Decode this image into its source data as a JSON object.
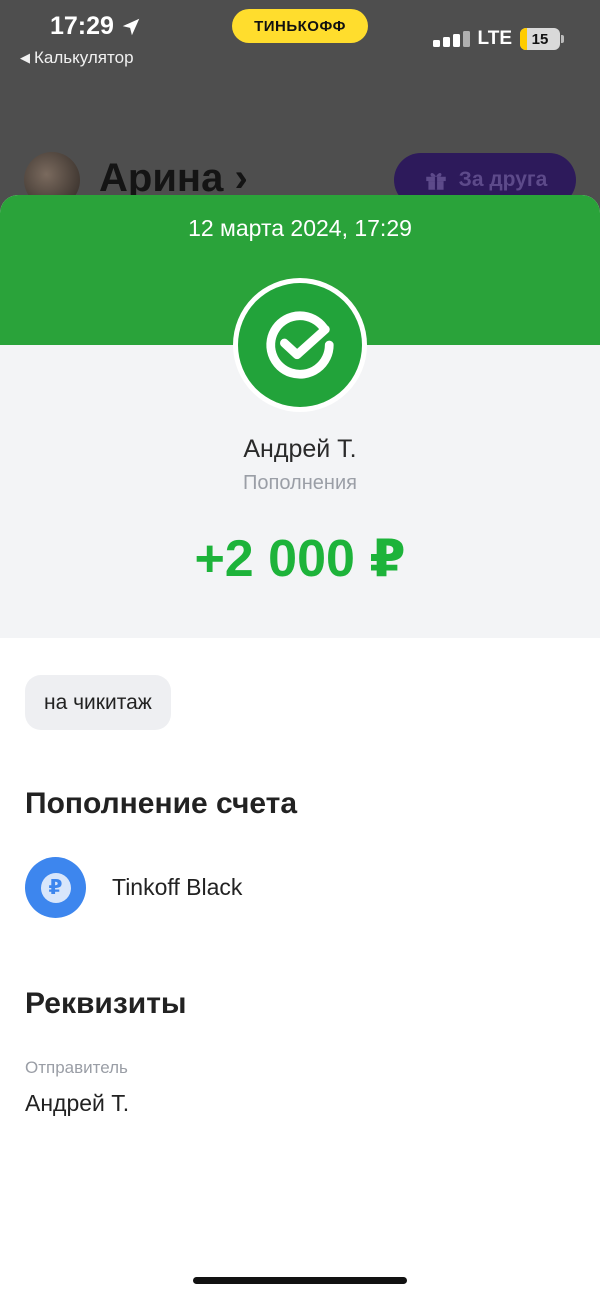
{
  "status_bar": {
    "time": "17:29",
    "back_app": "Калькулятор",
    "brand": "ТИНЬКОФФ",
    "network": "LTE",
    "battery": "15"
  },
  "background_header": {
    "name": "Арина",
    "gift_button": "За друга"
  },
  "transaction": {
    "datetime": "12 марта 2024, 17:29",
    "counterparty": "Андрей Т.",
    "category": "Пополнения",
    "amount": "+2 000 ₽",
    "comment": "на чикитаж"
  },
  "account_section": {
    "title": "Пополнение счета",
    "account_name": "Tinkoff Black",
    "account_icon": "ruble-icon"
  },
  "details_section": {
    "title": "Реквизиты",
    "sender_label": "Отправитель",
    "sender_value": "Андрей Т."
  },
  "colors": {
    "header_green": "#2aa33a",
    "amount_green": "#1db33a",
    "brand_yellow": "#ffdd2d",
    "account_blue": "#3d86ee"
  }
}
